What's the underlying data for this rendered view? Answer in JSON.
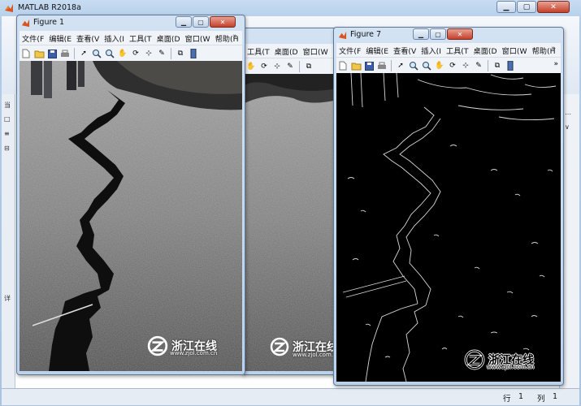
{
  "main": {
    "title": "MATLAB R2018a",
    "left_chars": [
      "当",
      "□",
      "≡",
      "⊟",
      "详"
    ],
    "right_chars": [
      "⋯",
      "∨"
    ],
    "status": {
      "row_label": "行",
      "row_value": "1",
      "col_label": "列",
      "col_value": "1"
    }
  },
  "menus": [
    "文件(F",
    "编辑(E",
    "查看(V",
    "插入(I",
    "工具(T",
    "桌面(D",
    "窗口(W",
    "帮助(H"
  ],
  "figures": [
    {
      "id": "fig1",
      "title": "Figure 1"
    },
    {
      "id": "fig2",
      "title": ""
    },
    {
      "id": "fig7",
      "title": "Figure 7"
    }
  ],
  "watermark": {
    "text": "浙江在线",
    "url": "www.zjol.com.cn"
  },
  "icons": {
    "new": "new-file-icon",
    "open": "open-folder-icon",
    "save": "save-disk-icon",
    "print": "print-icon",
    "pointer": "pointer-icon",
    "zoom_in": "zoom-in-icon",
    "zoom_out": "zoom-out-icon",
    "pan": "pan-hand-icon",
    "rotate": "rotate-3d-icon",
    "datatip": "data-cursor-icon",
    "brush": "brush-icon",
    "link": "link-plot-icon",
    "colorbar": "colorbar-icon"
  },
  "colors": {
    "titlebar": "#c7dcf2",
    "close": "#c4402a",
    "frame": "#5e7898"
  }
}
